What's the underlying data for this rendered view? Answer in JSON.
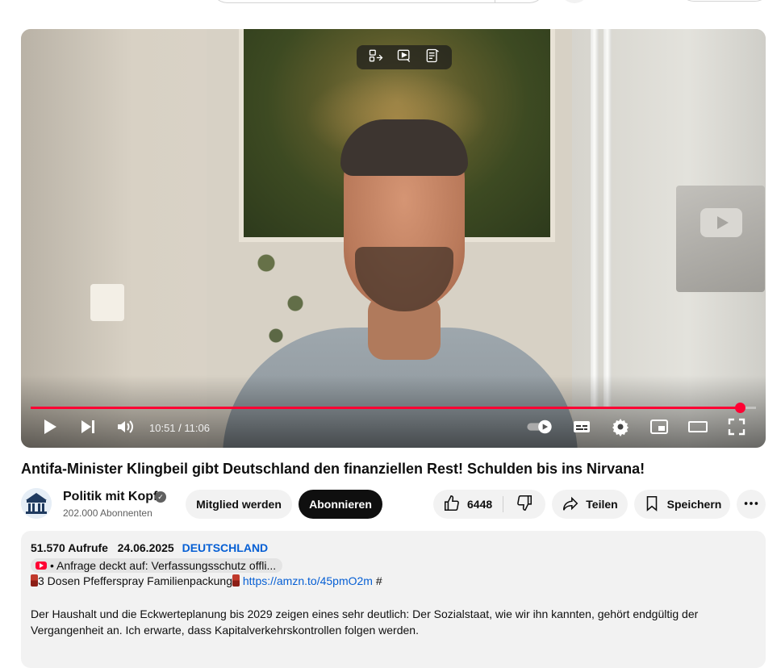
{
  "player": {
    "current_time": "10:51",
    "duration": "11:06",
    "progress_fraction": 0.9775,
    "accent_color": "#ff0033"
  },
  "video": {
    "title": "Antifa-Minister Klingbeil gibt Deutschland den finanziellen Rest! Schulden bis ins Nirvana!"
  },
  "channel": {
    "name": "Politik mit Kopf",
    "subscribers": "202.000 Abonnenten"
  },
  "actions": {
    "member_label": "Mitglied werden",
    "subscribe_label": "Abonnieren",
    "like_count": "6448",
    "share_label": "Teilen",
    "save_label": "Speichern"
  },
  "description": {
    "views": "51.570 Aufrufe",
    "date": "24.06.2025",
    "tag": "DEUTSCHLAND",
    "linked_video": "• Anfrage deckt auf: Verfassungsschutz offli...",
    "promo_text": "3 Dosen Pfefferspray Familienpackung",
    "promo_link": "https://amzn.to/45pmO2m",
    "promo_suffix": "#",
    "paragraph": "Der Haushalt und die Eckwerteplanung bis 2029 zeigen eines sehr deutlich: Der Sozialstaat, wie wir ihn kannten, gehört endgültig der Vergangenheit an. Ich erwarte, dass Kapitalverkehrskontrollen folgen werden."
  },
  "icons": {
    "overlay": [
      "shuffle-icon",
      "autoplay-icon",
      "notes-icon"
    ],
    "controls": [
      "play-icon",
      "next-icon",
      "volume-icon",
      "autoplay-toggle-icon",
      "subtitles-icon",
      "settings-icon",
      "miniplayer-icon",
      "theater-icon",
      "fullscreen-icon"
    ]
  }
}
